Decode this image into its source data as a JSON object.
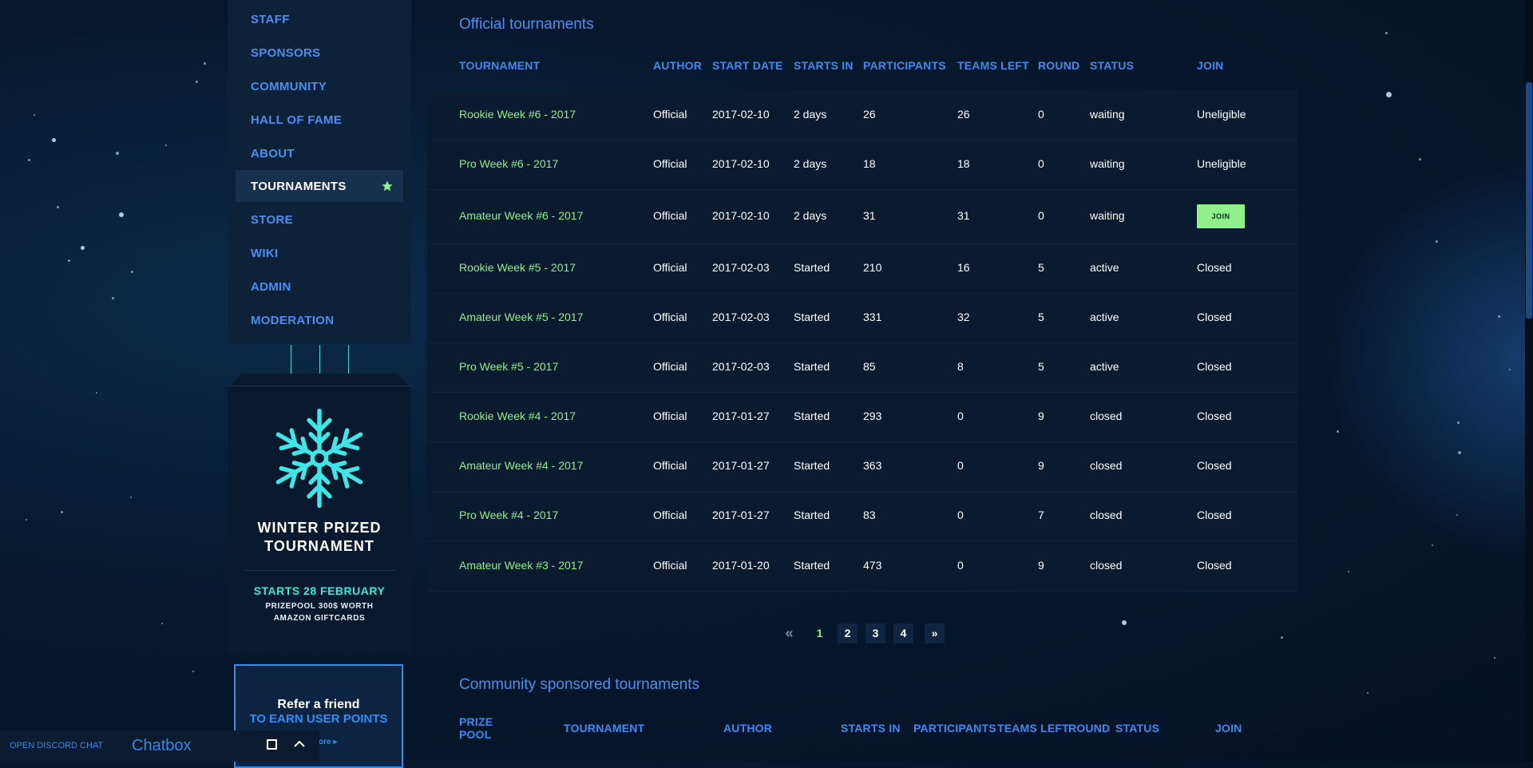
{
  "nav": {
    "items": [
      {
        "label": "STAFF",
        "active": false
      },
      {
        "label": "SPONSORS",
        "active": false
      },
      {
        "label": "COMMUNITY",
        "active": false
      },
      {
        "label": "HALL OF FAME",
        "active": false
      },
      {
        "label": "ABOUT",
        "active": false
      },
      {
        "label": "TOURNAMENTS",
        "active": true,
        "icon": "star-icon"
      },
      {
        "label": "STORE",
        "active": false
      },
      {
        "label": "WIKI",
        "active": false
      },
      {
        "label": "ADMIN",
        "active": false
      },
      {
        "label": "MODERATION",
        "active": false
      }
    ]
  },
  "promo": {
    "icon": "snowflake-icon",
    "title_line1": "WINTER PRIZED",
    "title_line2": "TOURNAMENT",
    "starts": "STARTS 28 FEBRUARY",
    "sub_line1": "PRIZEPOOL 300$ WORTH",
    "sub_line2": "AMAZON GIFTCARDS"
  },
  "refer": {
    "line1": "Refer a friend",
    "line2": "TO EARN USER POINTS",
    "more": "ore"
  },
  "chat": {
    "discord_label": "OPEN DISCORD CHAT",
    "title": "Chatbox"
  },
  "official": {
    "title": "Official tournaments",
    "headers": [
      "TOURNAMENT",
      "AUTHOR",
      "START DATE",
      "STARTS IN",
      "PARTICIPANTS",
      "TEAMS LEFT",
      "ROUND",
      "STATUS",
      "JOIN"
    ],
    "rows": [
      {
        "name": "Rookie Week #6 - 2017",
        "author": "Official",
        "date": "2017-02-10",
        "starts_in": "2 days",
        "participants": "26",
        "teams_left": "26",
        "round": "0",
        "status": "waiting",
        "join": "Uneligible",
        "join_button": false
      },
      {
        "name": "Pro Week #6 - 2017",
        "author": "Official",
        "date": "2017-02-10",
        "starts_in": "2 days",
        "participants": "18",
        "teams_left": "18",
        "round": "0",
        "status": "waiting",
        "join": "Uneligible",
        "join_button": false
      },
      {
        "name": "Amateur Week #6 - 2017",
        "author": "Official",
        "date": "2017-02-10",
        "starts_in": "2 days",
        "participants": "31",
        "teams_left": "31",
        "round": "0",
        "status": "waiting",
        "join": "JOIN",
        "join_button": true
      },
      {
        "name": "Rookie Week #5 - 2017",
        "author": "Official",
        "date": "2017-02-03",
        "starts_in": "Started",
        "participants": "210",
        "teams_left": "16",
        "round": "5",
        "status": "active",
        "join": "Closed",
        "join_button": false
      },
      {
        "name": "Amateur Week #5 - 2017",
        "author": "Official",
        "date": "2017-02-03",
        "starts_in": "Started",
        "participants": "331",
        "teams_left": "32",
        "round": "5",
        "status": "active",
        "join": "Closed",
        "join_button": false
      },
      {
        "name": "Pro Week #5 - 2017",
        "author": "Official",
        "date": "2017-02-03",
        "starts_in": "Started",
        "participants": "85",
        "teams_left": "8",
        "round": "5",
        "status": "active",
        "join": "Closed",
        "join_button": false
      },
      {
        "name": "Rookie Week #4 - 2017",
        "author": "Official",
        "date": "2017-01-27",
        "starts_in": "Started",
        "participants": "293",
        "teams_left": "0",
        "round": "9",
        "status": "closed",
        "join": "Closed",
        "join_button": false
      },
      {
        "name": "Amateur Week #4 - 2017",
        "author": "Official",
        "date": "2017-01-27",
        "starts_in": "Started",
        "participants": "363",
        "teams_left": "0",
        "round": "9",
        "status": "closed",
        "join": "Closed",
        "join_button": false
      },
      {
        "name": "Pro Week #4 - 2017",
        "author": "Official",
        "date": "2017-01-27",
        "starts_in": "Started",
        "participants": "83",
        "teams_left": "0",
        "round": "7",
        "status": "closed",
        "join": "Closed",
        "join_button": false
      },
      {
        "name": "Amateur Week #3 - 2017",
        "author": "Official",
        "date": "2017-01-20",
        "starts_in": "Started",
        "participants": "473",
        "teams_left": "0",
        "round": "9",
        "status": "closed",
        "join": "Closed",
        "join_button": false
      }
    ]
  },
  "pagination": {
    "prev": "«",
    "pages": [
      "1",
      "2",
      "3",
      "4"
    ],
    "current": "1",
    "next": "»"
  },
  "community": {
    "title": "Community sponsored tournaments",
    "headers": [
      "PRIZE POOL",
      "TOURNAMENT",
      "AUTHOR",
      "STARTS IN",
      "PARTICIPANTS",
      "TEAMS LEFT",
      "ROUND",
      "STATUS",
      "JOIN"
    ]
  },
  "colors": {
    "accent_blue": "#3d8bf0",
    "name_green": "#8ff08a",
    "promo_cyan": "#3ee6d8"
  }
}
